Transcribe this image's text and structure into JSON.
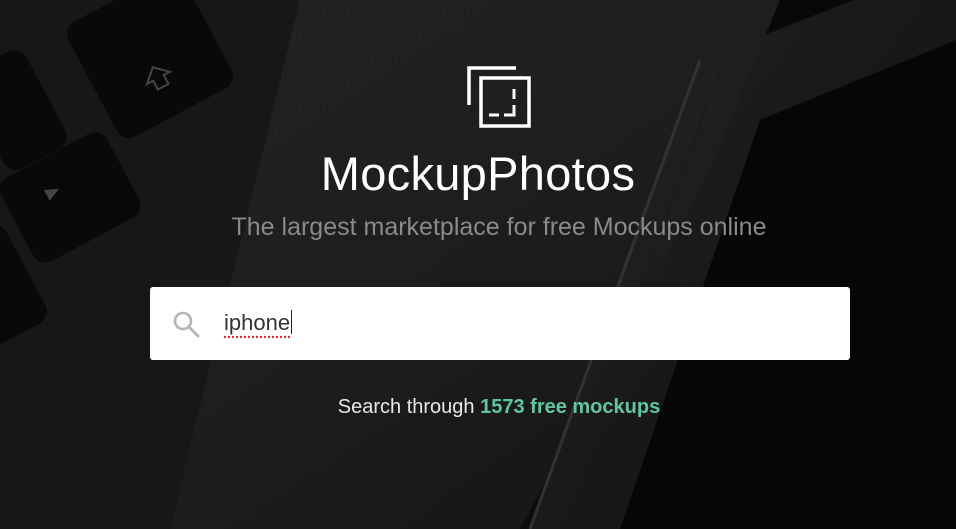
{
  "brand": {
    "name": "MockupPhotos",
    "tagline": "The largest marketplace for free Mockups online"
  },
  "search": {
    "value": "iphone",
    "icon": "search-icon"
  },
  "stats": {
    "prefix": "Search through",
    "count": "1573",
    "link_suffix": "free mockups"
  },
  "colors": {
    "accent": "#5fc6a4",
    "background": "#161616",
    "tagline": "#8a8a8a"
  },
  "icons": {
    "logo": "mockup-frame-logo-icon",
    "keyboard_arrow_up": "arrow-up-key-icon",
    "keyboard_play": "play-key-icon"
  }
}
